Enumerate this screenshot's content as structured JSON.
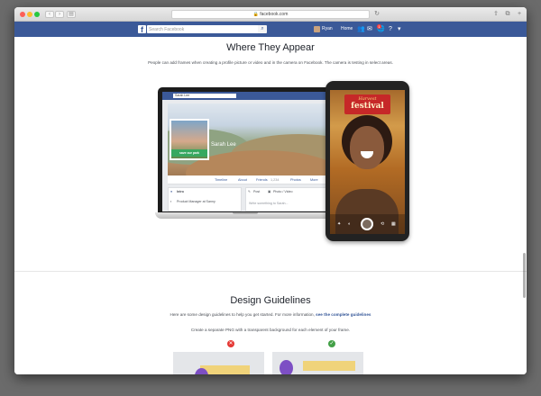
{
  "browser": {
    "url": "facebook.com",
    "traffic_lights": {
      "close": "#fc5f57",
      "minimize": "#fdbc2e",
      "zoom": "#28c840"
    }
  },
  "fb_bar": {
    "search_placeholder": "Search Facebook",
    "user_name": "Ryan",
    "home_label": "Home",
    "notification_count": "1",
    "brand_color": "#3b5998"
  },
  "where": {
    "title": "Where They Appear",
    "description": "People can add frames when creating a profile picture or video and in the camera on Facebook. The camera is testing in select areas."
  },
  "laptop": {
    "profile_name_search": "Sarah Lee",
    "profile_name": "Sarah Lee",
    "frame_text": "save our park",
    "tabs": [
      "Timeline",
      "About",
      "Friends",
      "Photos",
      "More"
    ],
    "friends_count": "1,234",
    "intro_label": "Intro",
    "intro_job": "Product Manager at Sanny",
    "composer_post": "Post",
    "composer_photo": "Photo / Video",
    "composer_placeholder": "Write something to Sarah..."
  },
  "phone": {
    "filter_small": "Harvest",
    "filter_big": "festival"
  },
  "design": {
    "title": "Design Guidelines",
    "text_before": "Here are some design guidelines to help you get started. For more information,",
    "link_text": "see the complete guidelines",
    "rule": "Create a separate PNG with a transparent background for each element of your frame.",
    "bad_mark": "✕",
    "good_mark": "✓",
    "bad_color": "#e53935",
    "good_color": "#43a047"
  }
}
